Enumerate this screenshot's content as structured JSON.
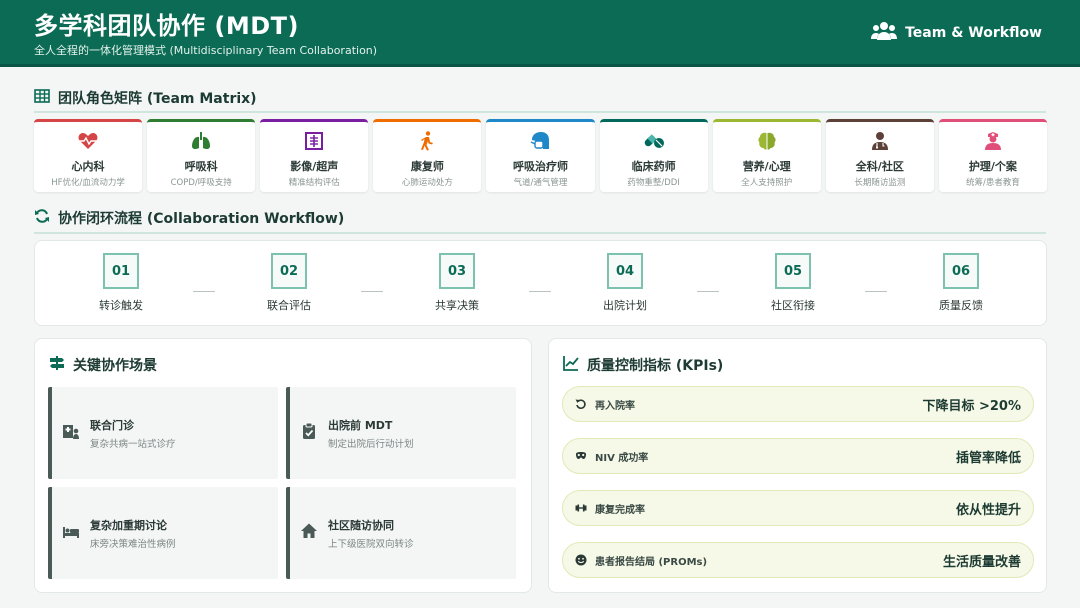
{
  "header": {
    "title": "多学科团队协作 (MDT)",
    "subtitle": "全人全程的一体化管理模式 (Multidisciplinary Team Collaboration)",
    "badge": "Team & Workflow"
  },
  "matrix": {
    "title": "团队角色矩阵 (Team Matrix)",
    "roles": [
      {
        "name": "心内科",
        "desc": "HF优化/血流动力学",
        "color": "#d64545",
        "icon": "heart-pulse-icon"
      },
      {
        "name": "呼吸科",
        "desc": "COPD/呼吸支持",
        "color": "#2e7d32",
        "icon": "lungs-icon"
      },
      {
        "name": "影像/超声",
        "desc": "精准结构评估",
        "color": "#7b1fa2",
        "icon": "x-ray-icon"
      },
      {
        "name": "康复师",
        "desc": "心肺运动处方",
        "color": "#ef6c00",
        "icon": "walking-icon"
      },
      {
        "name": "呼吸治疗师",
        "desc": "气道/通气管理",
        "color": "#1e88c8",
        "icon": "head-side-mask-icon"
      },
      {
        "name": "临床药师",
        "desc": "药物重整/DDI",
        "color": "#00695c",
        "icon": "pills-icon"
      },
      {
        "name": "营养/心理",
        "desc": "全人支持照护",
        "color": "#9cb833",
        "icon": "brain-icon"
      },
      {
        "name": "全科/社区",
        "desc": "长期随访监测",
        "color": "#5d4037",
        "icon": "user-doctor-icon"
      },
      {
        "name": "护理/个案",
        "desc": "统筹/患者教育",
        "color": "#e04f7a",
        "icon": "user-nurse-icon"
      }
    ]
  },
  "workflow": {
    "title": "协作闭环流程 (Collaboration Workflow)",
    "steps": [
      {
        "num": "01",
        "label": "转诊触发"
      },
      {
        "num": "02",
        "label": "联合评估"
      },
      {
        "num": "03",
        "label": "共享决策"
      },
      {
        "num": "04",
        "label": "出院计划"
      },
      {
        "num": "05",
        "label": "社区衔接"
      },
      {
        "num": "06",
        "label": "质量反馈"
      }
    ]
  },
  "scenarios": {
    "title": "关键协作场景",
    "items": [
      {
        "title": "联合门诊",
        "desc": "复杂共病一站式诊疗",
        "icon": "hospital-user-icon"
      },
      {
        "title": "出院前 MDT",
        "desc": "制定出院后行动计划",
        "icon": "clipboard-check-icon"
      },
      {
        "title": "复杂加重期讨论",
        "desc": "床旁决策难治性病例",
        "icon": "bed-icon"
      },
      {
        "title": "社区随访协同",
        "desc": "上下级医院双向转诊",
        "icon": "house-icon"
      }
    ]
  },
  "kpis": {
    "title": "质量控制指标 (KPIs)",
    "items": [
      {
        "name": "再入院率",
        "value": "下降目标 >20%",
        "icon": "rotate-left-icon"
      },
      {
        "name": "NIV 成功率",
        "value": "插管率降低",
        "icon": "mask-icon"
      },
      {
        "name": "康复完成率",
        "value": "依从性提升",
        "icon": "dumbbell-icon"
      },
      {
        "name": "患者报告结局 (PROMs)",
        "value": "生活质量改善",
        "icon": "smile-icon"
      }
    ]
  }
}
